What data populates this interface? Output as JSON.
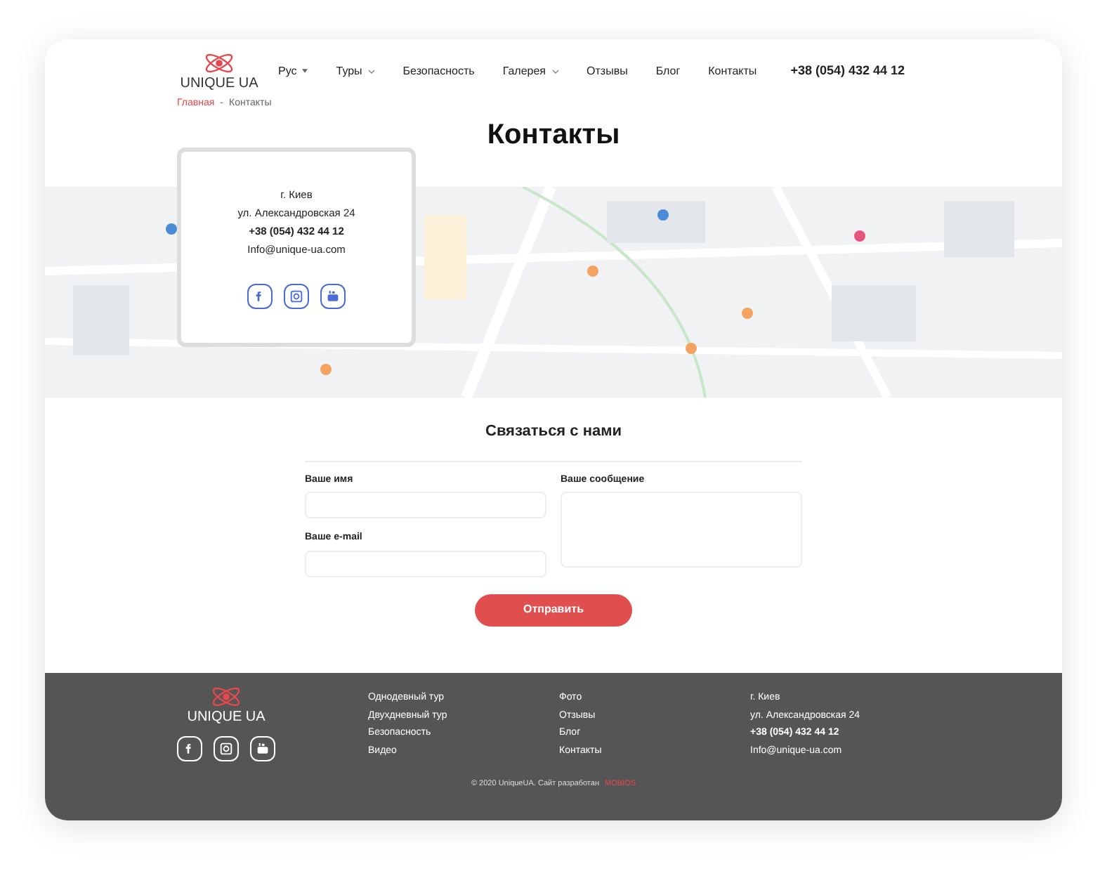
{
  "logo": {
    "text": "UNIQUE UA"
  },
  "language": {
    "label": "Рус"
  },
  "nav": [
    {
      "label": "Туры",
      "has_dropdown": true
    },
    {
      "label": "Безопасность",
      "has_dropdown": false
    },
    {
      "label": "Галерея",
      "has_dropdown": true
    },
    {
      "label": "Отзывы",
      "has_dropdown": false
    },
    {
      "label": "Блог",
      "has_dropdown": false
    },
    {
      "label": "Контакты",
      "has_dropdown": false
    }
  ],
  "phone": "+38 (054) 432 44 12",
  "breadcrumb": [
    {
      "label": "Главная",
      "link": true
    },
    {
      "label": "Контакты",
      "link": false
    }
  ],
  "breadcrumb_separator": "-",
  "page_title": "Контакты",
  "contact_card": {
    "lines": [
      "г. Киев",
      "ул. Александровская 24",
      "+38 (054) 432 44 12",
      "Info@unique-ua.com"
    ],
    "social": [
      {
        "kind": "facebook"
      },
      {
        "kind": "instagram"
      },
      {
        "kind": "youtube"
      }
    ]
  },
  "form": {
    "title": "Связаться с нами",
    "name_label": "Ваше имя",
    "email_label": "Ваше e-mail",
    "message_label": "Ваше сообщение",
    "submit": "Отправить"
  },
  "footer": {
    "logo": "UNIQUE UA",
    "social": [
      {
        "kind": "facebook"
      },
      {
        "kind": "instagram"
      },
      {
        "kind": "youtube"
      }
    ],
    "columns": [
      [
        "Однодевный тур",
        "Двухдневный тур",
        "Безопасность",
        "Видео"
      ],
      [
        "Фото",
        "Отзывы",
        "Блог",
        "Контакты"
      ],
      [
        "г. Киев",
        "ул. Александровская 24",
        "+38 (054) 432 44 12",
        "Info@unique-ua.com"
      ]
    ],
    "copyright": "© 2020 UniqueUA. Сайт разработан",
    "developer": "MOBIOS"
  }
}
